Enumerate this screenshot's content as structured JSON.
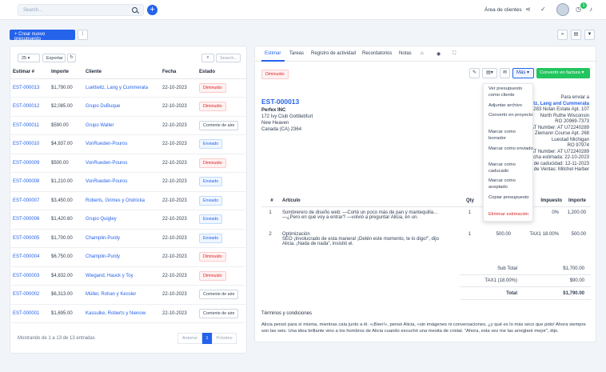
{
  "topbar": {
    "search_placeholder": "Search...",
    "client_area": "Área de clientes",
    "notification_count": "1"
  },
  "toolbar": {
    "new_estimate": "+ Crear nuevo presupuesto"
  },
  "list": {
    "page_size": "25",
    "export": "Exportar",
    "search_placeholder": "Search...",
    "columns": [
      "Estimar #",
      "Importe",
      "Cliente",
      "Fecha",
      "Estado"
    ],
    "rows": [
      {
        "id": "EST-000013",
        "amount": "$1,790.00",
        "client": "Luettwitz, Lang y Cummerata",
        "date": "22-10-2023",
        "status": "Diminuido",
        "color": "red"
      },
      {
        "id": "EST-000012",
        "amount": "$2,085.00",
        "client": "Grupo DuBuque",
        "date": "22-10-2023",
        "status": "Diminuido",
        "color": "red"
      },
      {
        "id": "EST-000011",
        "amount": "$590.00",
        "client": "Grupo Walter",
        "date": "22-10-2023",
        "status": "Corriente de aire",
        "color": "gray"
      },
      {
        "id": "EST-000010",
        "amount": "$4,937.00",
        "client": "VonRueden-Pouros",
        "date": "22-10-2023",
        "status": "Enviado",
        "color": "blue"
      },
      {
        "id": "EST-000009",
        "amount": "$500.00",
        "client": "VonRueden-Pouros",
        "date": "22-10-2023",
        "status": "Diminuido",
        "color": "red"
      },
      {
        "id": "EST-000008",
        "amount": "$1,210.00",
        "client": "VonRueden-Pouros",
        "date": "22-10-2023",
        "status": "Enviado",
        "color": "blue"
      },
      {
        "id": "EST-000007",
        "amount": "$3,450.00",
        "client": "Roberts, Grimes y Ondricka",
        "date": "22-10-2023",
        "status": "Enviado",
        "color": "blue"
      },
      {
        "id": "EST-000006",
        "amount": "$1,420.60",
        "client": "Grupo Quigley",
        "date": "22-10-2023",
        "status": "Enviado",
        "color": "blue"
      },
      {
        "id": "EST-000005",
        "amount": "$1,700.00",
        "client": "Champlin-Purdy",
        "date": "22-10-2023",
        "status": "Enviado",
        "color": "blue"
      },
      {
        "id": "EST-000004",
        "amount": "$6,750.00",
        "client": "Champlin-Purdy",
        "date": "22-10-2023",
        "status": "Diminuido",
        "color": "red"
      },
      {
        "id": "EST-000003",
        "amount": "$4,832.00",
        "client": "Wiegand, Hauck y Toy",
        "date": "22-10-2023",
        "status": "Diminuido",
        "color": "red"
      },
      {
        "id": "EST-000002",
        "amount": "$6,313.00",
        "client": "Müller, Rohan y Kessler",
        "date": "22-10-2023",
        "status": "Corriente de aire",
        "color": "gray"
      },
      {
        "id": "EST-000001",
        "amount": "$1,695.00",
        "client": "Kassulke, Roberts y Nienow",
        "date": "22-10-2023",
        "status": "Corriente de aire",
        "color": "gray"
      }
    ],
    "footer": "Mostrando de 1 a 13 de 13 entradas",
    "prev": "Anterior",
    "page": "1",
    "next": "Próximo"
  },
  "detail": {
    "tabs": [
      "Estimar",
      "Tareas",
      "Registro de actividad",
      "Recordatorios",
      "Notas"
    ],
    "status": "Diminuido",
    "more": "Más",
    "convert": "Convertir en factura",
    "number": "EST-000013",
    "from": [
      "Perfex INC",
      "172 Ivy Club Gottliebfurt",
      "New Heaven",
      "Canada (CA) 2364"
    ],
    "to_title": "Para enviar a",
    "to_client": "Luettwitz, Lang and Cummerata",
    "to_lines": [
      "283 Nolan Estate Apt. 107",
      "North Ruthe Wisconsin",
      "RO 20969-7373",
      "VAT Number: AT U72240289"
    ],
    "ship_lines": [
      "8 Ziemann Course Apt. 268",
      "Luestad Michigan",
      "RO 97974",
      "VAT Number: AT U72240289"
    ],
    "dates": [
      "Fecha estimada: 22-10-2023",
      "Fecha de caducidad: 12-11-2023",
      "Agente de Ventas: Mitchel Harber"
    ],
    "item_cols": [
      "#",
      "Artículo",
      "Qty",
      "Impuesto",
      "Importe"
    ],
    "items": [
      {
        "n": "1",
        "name": "Sombrerero de diseño web: —Corté un poco más de pan y mantequilla...",
        "desc": "—¿Pero en qué voy a entrar? —volvió a preguntar Alicia, en un.",
        "qty": "1",
        "tax": "0%",
        "amount": "1,200.00"
      },
      {
        "n": "2",
        "name": "Optimización",
        "desc": "SEO ¡Involucrado de esta manera! ¡Detén este momento, te lo digo!\", dijo Alicia. ¡Nada de nada\", insistió el.",
        "qty": "1",
        "rate": "500.00",
        "tax": "TAX1 18.00%",
        "amount": "500.00"
      }
    ],
    "totals": [
      {
        "label": "Sub Total",
        "value": "$1,700.00"
      },
      {
        "label": "TAX1 (18.00%)",
        "value": "$90.00"
      },
      {
        "label": "Total",
        "value": "$1,790.00"
      }
    ],
    "terms_title": "Términos y condiciones",
    "terms": "Alicia pensó para sí misma, mientras caía junto a él. «¡Bien!», pensó Alicia, «sin imágenes ni conversaciones, ¿y qué es lo más seco que pido! Ahora siempre son las seis. Una idea brillante vino a los hombros de Alicia cuando escuchó una mesita de cristal. \"Ahora, esta vez me las arreglaré mejor\", dijo."
  },
  "menu": [
    "Ver presupuesto como cliente",
    "Adjuntar archivo",
    "Convertir en proyecto",
    "Marcar como borrador",
    "Marcar como enviado",
    "Marcar como caducado",
    "Marcar como aceptado",
    "Copiar presupuesto",
    "Eliminar estimación"
  ]
}
